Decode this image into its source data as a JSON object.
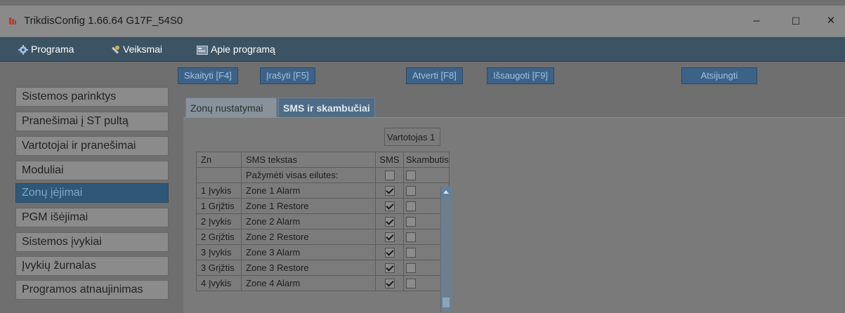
{
  "window": {
    "title": "TrikdisConfig 1.66.64   G17F_54S0",
    "minimize": "–",
    "maximize": "☐",
    "close": "✕"
  },
  "menu": {
    "items": [
      {
        "label": "Programa",
        "icon": "gear-icon"
      },
      {
        "label": "Veiksmai",
        "icon": "wrench-icon"
      },
      {
        "label": "Apie programą",
        "icon": "info-panel-icon"
      }
    ]
  },
  "toolbar": {
    "read": "Skaityti [F4]",
    "write": "Įrašyti [F5]",
    "open": "Atverti [F8]",
    "save": "Išsaugoti [F9]",
    "disconnect": "Atsijungti"
  },
  "sidebar": {
    "items": [
      {
        "label": "Sistemos parinktys",
        "active": false
      },
      {
        "label": "Pranešimai į ST pultą",
        "active": false
      },
      {
        "label": "Vartotojai ir pranešimai",
        "active": false
      },
      {
        "label": "Moduliai",
        "active": false
      },
      {
        "label": "Zonų įėjimai",
        "active": true
      },
      {
        "label": "PGM išėjimai",
        "active": false
      },
      {
        "label": "Sistemos įvykiai",
        "active": false
      },
      {
        "label": "Įvykių žurnalas",
        "active": false
      },
      {
        "label": "Programos atnaujinimas",
        "active": false
      }
    ]
  },
  "tabs": [
    {
      "label": "Zonų nustatymai",
      "active": false
    },
    {
      "label": "SMS ir skambučiai",
      "active": true
    }
  ],
  "table": {
    "group_header": "Vartotojas 1",
    "columns": {
      "zn": "Zn",
      "text": "SMS tekstas",
      "sms": "SMS",
      "call": "Skambutis"
    },
    "select_all_label": "Pažymėti visas eilutes:",
    "rows": [
      {
        "zn": "1 Įvykis",
        "text": "Zone 1 Alarm",
        "sms": true,
        "call": false
      },
      {
        "zn": "1 Grįžtis",
        "text": "Zone 1 Restore",
        "sms": true,
        "call": false
      },
      {
        "zn": "2 Įvykis",
        "text": "Zone 2 Alarm",
        "sms": true,
        "call": false
      },
      {
        "zn": "2 Grįžtis",
        "text": "Zone 2 Restore",
        "sms": true,
        "call": false
      },
      {
        "zn": "3 Įvykis",
        "text": "Zone 3 Alarm",
        "sms": true,
        "call": false
      },
      {
        "zn": "3 Grįžtis",
        "text": "Zone 3 Restore",
        "sms": true,
        "call": false
      },
      {
        "zn": "4 Įvykis",
        "text": "Zone 4 Alarm",
        "sms": true,
        "call": false
      }
    ]
  },
  "colors": {
    "menubar": "#3c5364",
    "active_sidebar": "#2f5878",
    "toolbar_button": "#3d6287"
  }
}
